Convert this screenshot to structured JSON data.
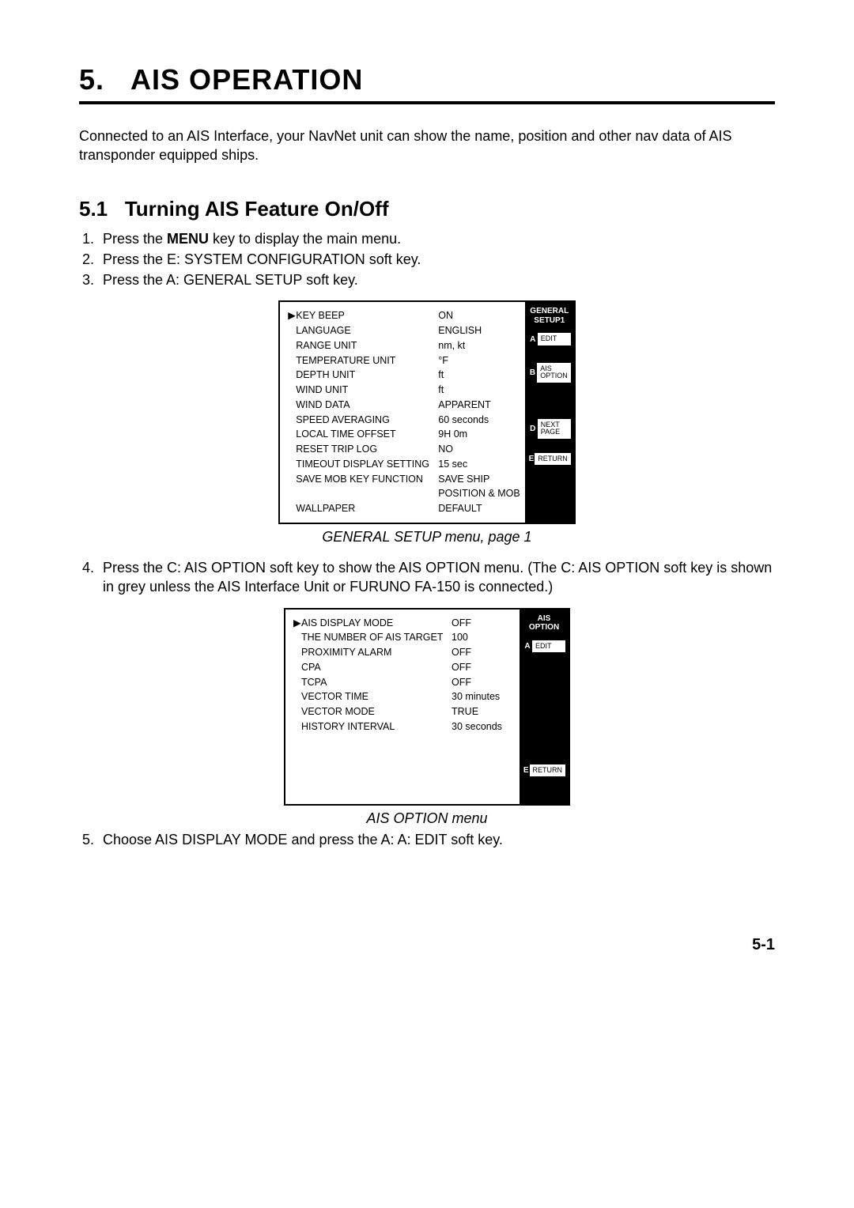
{
  "chapter": {
    "number": "5.",
    "title": "AIS OPERATION"
  },
  "intro": "Connected to an AIS Interface, your NavNet unit can show the name, position and other nav data of AIS transponder equipped ships.",
  "section": {
    "number": "5.1",
    "title": "Turning AIS Feature On/Off"
  },
  "steps_top": [
    {
      "pre": "Press the ",
      "bold": "MENU",
      "post": " key to display the main menu."
    },
    {
      "pre": "Press the E: SYSTEM CONFIGURATION soft key.",
      "bold": "",
      "post": ""
    },
    {
      "pre": "Press the A: GENERAL SETUP soft key.",
      "bold": "",
      "post": ""
    }
  ],
  "general_menu": {
    "rows": [
      {
        "ptr": "▶",
        "label": "KEY BEEP",
        "value": "ON"
      },
      {
        "ptr": "",
        "label": "LANGUAGE",
        "value": "ENGLISH"
      },
      {
        "ptr": "",
        "label": "RANGE UNIT",
        "value": "nm, kt"
      },
      {
        "ptr": "",
        "label": "TEMPERATURE UNIT",
        "value": "°F"
      },
      {
        "ptr": "",
        "label": "DEPTH UNIT",
        "value": "ft"
      },
      {
        "ptr": "",
        "label": "WIND UNIT",
        "value": "ft"
      },
      {
        "ptr": "",
        "label": "WIND DATA",
        "value": "APPARENT"
      },
      {
        "ptr": "",
        "label": "SPEED AVERAGING",
        "value": "60 seconds"
      },
      {
        "ptr": "",
        "label": "LOCAL TIME OFFSET",
        "value": "9H 0m"
      },
      {
        "ptr": "",
        "label": "RESET TRIP LOG",
        "value": "NO"
      },
      {
        "ptr": "",
        "label": "TIMEOUT DISPLAY SETTING",
        "value": "15 sec"
      },
      {
        "ptr": "",
        "label": "SAVE MOB KEY FUNCTION",
        "value": "SAVE SHIP"
      }
    ],
    "extra_line": "POSITION & MOB",
    "wallpaper": {
      "label": "WALLPAPER",
      "value": "DEFAULT"
    },
    "side_title_l1": "GENERAL",
    "side_title_l2": "SETUP1",
    "softkeys": [
      {
        "letter": "A",
        "label": "EDIT"
      },
      {
        "letter": "B",
        "label": "AIS\nOPTION"
      },
      {
        "letter": "D",
        "label": "NEXT\nPAGE"
      },
      {
        "letter": "E",
        "label": "RETURN"
      }
    ],
    "caption": "GENERAL SETUP menu, page 1"
  },
  "step4": "Press the C: AIS OPTION soft key to show the AIS OPTION menu. (The C: AIS OPTION soft key is shown in grey unless the AIS Interface Unit or FURUNO FA-150 is connected.)",
  "ais_menu": {
    "rows": [
      {
        "ptr": "▶",
        "label": "AIS DISPLAY MODE",
        "value": "OFF"
      },
      {
        "ptr": "",
        "label": "THE NUMBER OF AIS TARGET",
        "value": "100"
      },
      {
        "ptr": "",
        "label": "PROXIMITY ALARM",
        "value": "OFF"
      },
      {
        "ptr": "",
        "label": "CPA",
        "value": "OFF"
      },
      {
        "ptr": "",
        "label": "TCPA",
        "value": "OFF"
      },
      {
        "ptr": "",
        "label": "VECTOR TIME",
        "value": "30 minutes"
      },
      {
        "ptr": "",
        "label": "VECTOR MODE",
        "value": "TRUE"
      },
      {
        "ptr": "",
        "label": "HISTORY INTERVAL",
        "value": "30 seconds"
      }
    ],
    "side_title_l1": "AIS",
    "side_title_l2": "OPTION",
    "softkeys": [
      {
        "letter": "A",
        "label": "EDIT"
      },
      {
        "letter": "E",
        "label": "RETURN"
      }
    ],
    "caption": "AIS OPTION menu"
  },
  "step5": "Choose AIS DISPLAY MODE and press the A: A: EDIT soft key.",
  "page_number": "5-1"
}
